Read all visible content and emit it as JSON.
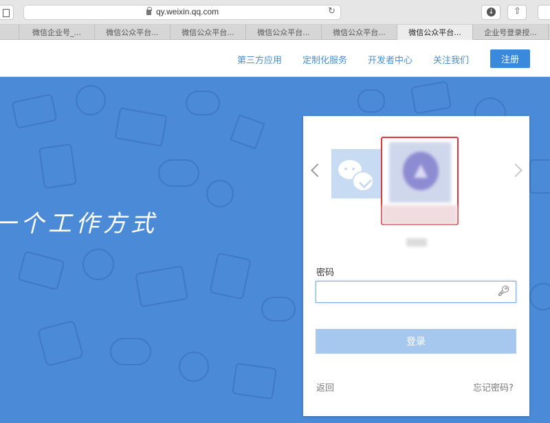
{
  "browser": {
    "url": "qy.weixin.qq.com",
    "tabs": [
      {
        "label": "",
        "active": false
      },
      {
        "label": "微信企业号_...",
        "active": false
      },
      {
        "label": "微信公众平台...",
        "active": false
      },
      {
        "label": "微信公众平台...",
        "active": false
      },
      {
        "label": "微信公众平台...",
        "active": false
      },
      {
        "label": "微信公众平台...",
        "active": false
      },
      {
        "label": "微信公众平台...",
        "active": true
      },
      {
        "label": "企业号登录授...",
        "active": false
      }
    ]
  },
  "header": {
    "nav": [
      "第三方应用",
      "定制化服务",
      "开发者中心",
      "关注我们"
    ],
    "register_label": "注册"
  },
  "hero": {
    "slogan": "一个工作方式"
  },
  "login": {
    "password_label": "密码",
    "password_value": "",
    "login_label": "登录",
    "back_label": "返回",
    "forgot_label": "忘记密码?"
  },
  "colors": {
    "hero_bg": "#4a8ad6",
    "accent": "#3b89dc",
    "highlight": "#e0353b",
    "nav_text": "#4a8fd5"
  },
  "icons": [
    "sidebar-icon",
    "lock-icon",
    "reload-icon",
    "download-icon",
    "share-icon",
    "tabs-icon",
    "chevron-left-icon",
    "chevron-right-icon",
    "wechat-icon",
    "key-icon"
  ]
}
